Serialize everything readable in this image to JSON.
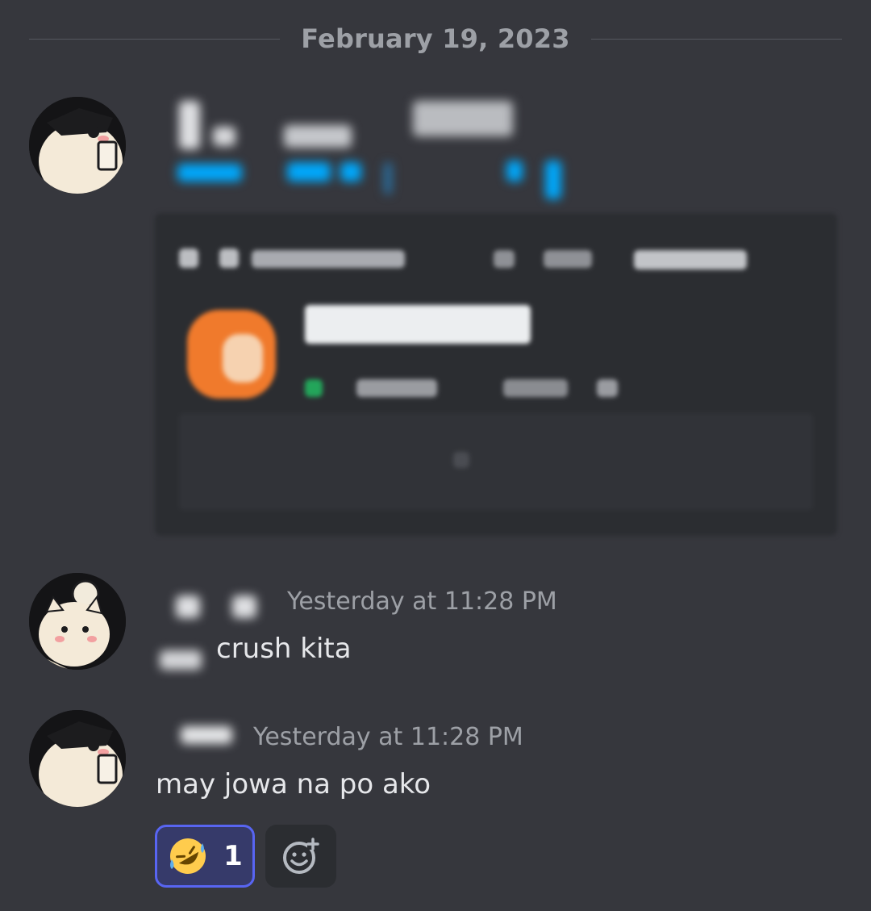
{
  "date_divider": "February 19, 2023",
  "messages": [
    {
      "author": "",
      "time": "",
      "text": ""
    },
    {
      "author": "",
      "time": "Yesterday at 11:28 PM",
      "text": "crush kita"
    },
    {
      "author": "",
      "time": "Yesterday at 11:28 PM",
      "text": "may jowa na po ako"
    }
  ],
  "reactions": [
    {
      "emoji": "rolling-on-floor-laughing",
      "count": "1",
      "active": true
    }
  ],
  "icons": {
    "reaction_emoji": "rofl-emoji-icon",
    "add_reaction": "add-reaction-icon"
  },
  "colors": {
    "background": "#36373d",
    "blurple": "#5865f2",
    "muted_text": "#9da0a6",
    "link_blue": "#00a8fc"
  }
}
